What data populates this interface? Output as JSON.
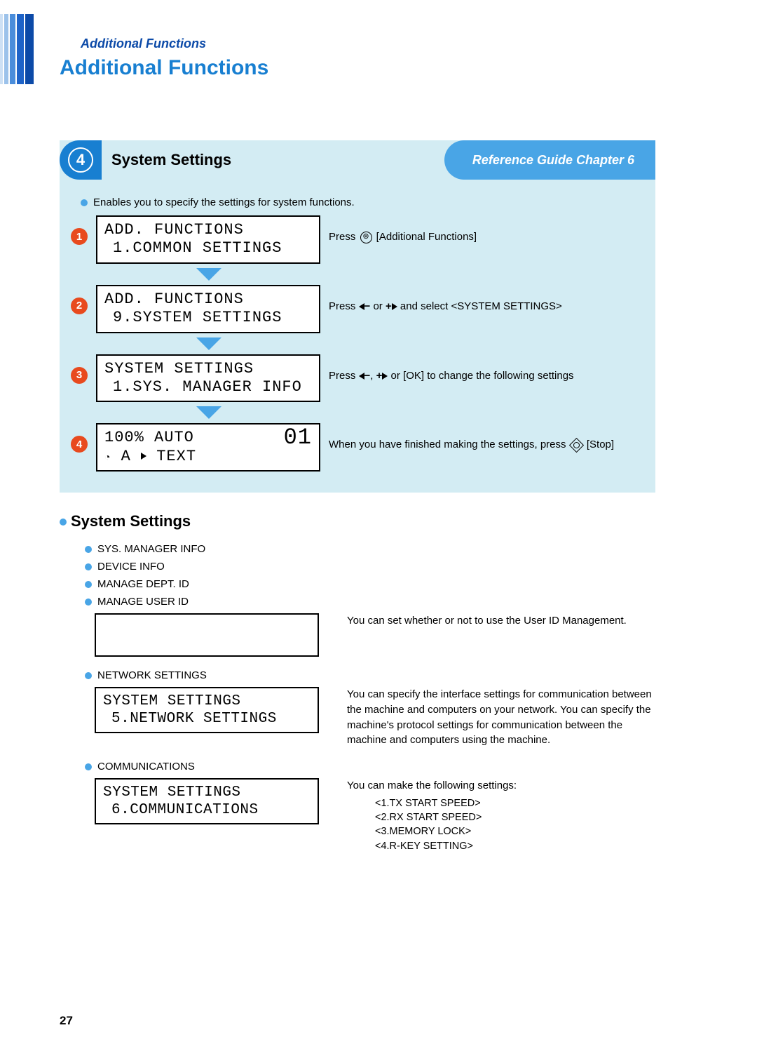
{
  "header_label": "Additional Functions",
  "page_title": "Additional Functions",
  "section": {
    "number": "4",
    "title": "System Settings",
    "reference": "Reference Guide Chapter 6",
    "intro": "Enables you to specify the settings for system functions.",
    "steps": [
      {
        "badge": "1",
        "lcd_line1": "ADD. FUNCTIONS",
        "lcd_line2": "1.COMMON SETTINGS",
        "desc_pre": "Press ",
        "desc_post": " [Additional Functions]"
      },
      {
        "badge": "2",
        "lcd_line1": "ADD. FUNCTIONS",
        "lcd_line2": "9.SYSTEM SETTINGS",
        "desc_pre": "Press ",
        "desc_mid": " or ",
        "desc_post": " and select <SYSTEM SETTINGS>"
      },
      {
        "badge": "3",
        "lcd_line1": "SYSTEM SETTINGS",
        "lcd_line2": "1.SYS. MANAGER INFO",
        "desc_pre": "Press ",
        "desc_mid2": " or [OK] to change the following settings"
      },
      {
        "badge": "4",
        "lcd_line1": "100%   AUTO",
        "lcd_line2": "  A    TEXT",
        "lcd_big": "01",
        "desc_pre": "When you have finished making the settings, press ",
        "desc_post": " [Stop]"
      }
    ]
  },
  "sub": {
    "title": "System Settings",
    "items": [
      {
        "label": "SYS. MANAGER INFO"
      },
      {
        "label": "DEVICE INFO"
      },
      {
        "label": "MANAGE DEPT. ID"
      },
      {
        "label": "MANAGE USER ID",
        "desc": "You can set whether or not to use the User ID Management.",
        "lcd_blank": true
      },
      {
        "label": "NETWORK SETTINGS",
        "lcd1": "SYSTEM SETTINGS",
        "lcd2": "5.NETWORK SETTINGS",
        "desc": "You can specify the interface settings for communication between the machine and computers on your network. You can specify the machine's protocol settings for communication between the machine and computers using the machine."
      },
      {
        "label": "COMMUNICATIONS",
        "lcd1": "SYSTEM SETTINGS",
        "lcd2": "6.COMMUNICATIONS",
        "desc": "You can make the following settings:",
        "sub": [
          "<1.TX START SPEED>",
          "<2.RX START SPEED>",
          "<3.MEMORY LOCK>",
          "<4.R-KEY SETTING>"
        ]
      }
    ]
  },
  "page_number": "27"
}
